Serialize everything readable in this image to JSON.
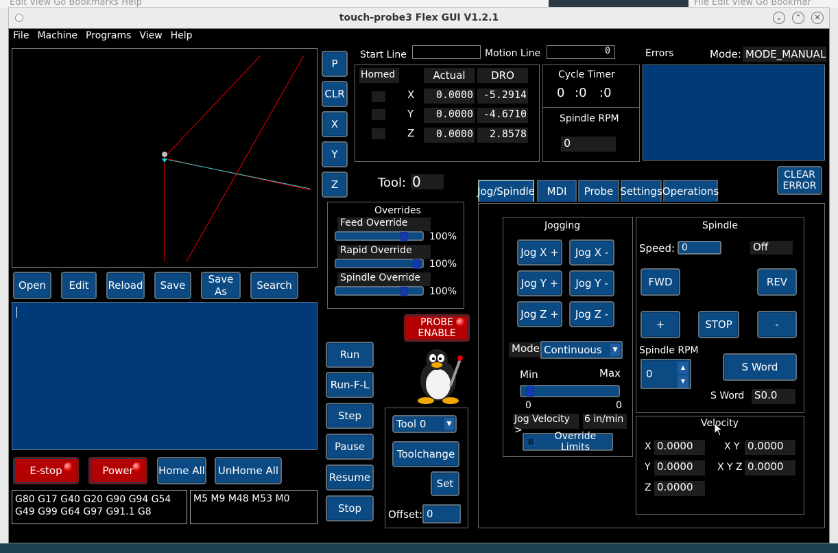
{
  "window": {
    "title": "touch-probe3 Flex GUI V1.2.1"
  },
  "bg": {
    "menu_left": "Edit   View   Go   Bookmarks   Help",
    "menu_right": "File   Edit   View   Go   Bookmar"
  },
  "menu": [
    "File",
    "Machine",
    "Programs",
    "View",
    "Help"
  ],
  "side_buttons": [
    "P",
    "CLR",
    "X",
    "Y",
    "Z"
  ],
  "start_line": {
    "label": "Start Line",
    "value": ""
  },
  "motion_line": {
    "label": "Motion Line",
    "value": "0"
  },
  "errors": {
    "label": "Errors"
  },
  "mode": {
    "label": "Mode:",
    "value": "MODE_MANUAL"
  },
  "dro": {
    "homed": "Homed",
    "actual": "Actual",
    "dro": "DRO",
    "rows": [
      {
        "axis": "X",
        "actual": "0.0000",
        "dro": "-5.2914"
      },
      {
        "axis": "Y",
        "actual": "0.0000",
        "dro": "-4.6710"
      },
      {
        "axis": "Z",
        "actual": "0.0000",
        "dro": "2.8578"
      }
    ]
  },
  "cycle_timer": {
    "label": "Cycle Timer",
    "h": "0",
    "m": ":0",
    "s": ":0"
  },
  "spindle_rpm_top": {
    "label": "Spindle RPM",
    "value": "0"
  },
  "clear_error": "CLEAR ERROR",
  "tool": {
    "label": "Tool:",
    "value": "0"
  },
  "tabs": [
    "Jog/Spindle",
    "MDI",
    "Probe",
    "Settings",
    "Operations"
  ],
  "file_buttons": [
    "Open",
    "Edit",
    "Reload",
    "Save",
    "Save As",
    "Search"
  ],
  "overrides": {
    "title": "Overrides",
    "items": [
      {
        "label": "Feed Override",
        "value": "100%",
        "pos": 0.83
      },
      {
        "label": "Rapid Override",
        "value": "100%",
        "pos": 0.93
      },
      {
        "label": "Spindle Override",
        "value": "100%",
        "pos": 0.83
      }
    ]
  },
  "probe_enable": "PROBE ENABLE",
  "run_buttons": [
    "Run",
    "Run-F-L",
    "Step",
    "Pause",
    "Resume",
    "Stop"
  ],
  "bottom_buttons": {
    "estop": "E-stop",
    "power": "Power",
    "home_all": "Home All",
    "unhome_all": "UnHome All"
  },
  "gcodes": "G80 G17 G40 G20 G90 G94 G54 G49 G99 G64 G97 G91.1 G8",
  "mcodes": "M5 M9 M48 M53 M0",
  "tool_panel": {
    "select": "Tool 0",
    "toolchange": "Toolchange",
    "set": "Set",
    "offset_label": "Offset:",
    "offset_value": "0"
  },
  "jogging": {
    "title": "Jogging",
    "buttons": [
      "Jog X +",
      "Jog X -",
      "Jog Y +",
      "Jog Y -",
      "Jog Z +",
      "Jog Z -"
    ],
    "mode_label": "Mode",
    "mode_value": "Continuous",
    "min": "Min",
    "max": "Max",
    "min_val": "0",
    "max_val": "0",
    "velocity_label": "Jog Velocity >",
    "velocity_value": "6 in/min",
    "override_limits": "Override Limits"
  },
  "spindle": {
    "title": "Spindle",
    "speed_label": "Speed:",
    "speed_value": "0",
    "state": "Off",
    "fwd": "FWD",
    "rev": "REV",
    "plus": "+",
    "stop": "STOP",
    "minus": "-",
    "rpm_label": "Spindle RPM",
    "rpm_value": "0",
    "sword_btn": "S Word",
    "sword_label": "S Word",
    "sword_value": "S0.0"
  },
  "velocity": {
    "title": "Velocity",
    "x_label": "X",
    "x": "0.0000",
    "xy_label": "X Y",
    "xy": "0.0000",
    "y_label": "Y",
    "y": "0.0000",
    "xyz_label": "X Y Z",
    "xyz": "0.0000",
    "z_label": "Z",
    "z": "0.0000"
  }
}
